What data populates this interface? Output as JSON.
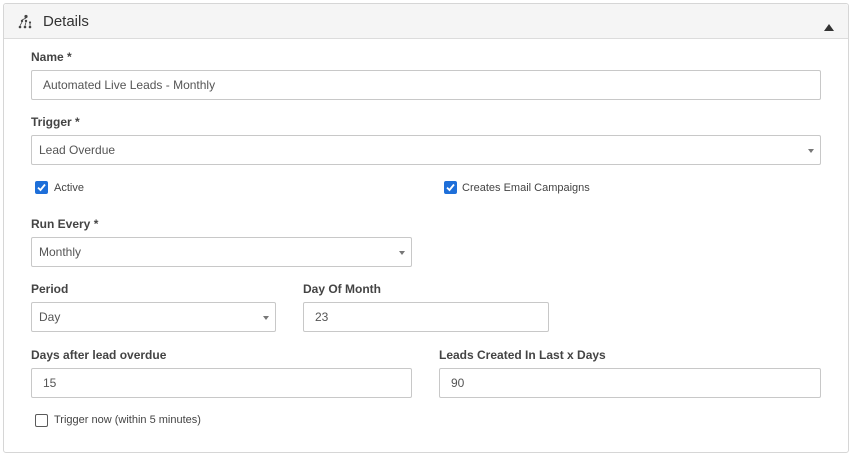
{
  "panel": {
    "title": "Details",
    "icon": "sitemap-icon",
    "collapse_icon": "caret-up-icon"
  },
  "form": {
    "name": {
      "label": "Name *",
      "value": "Automated Live Leads - Monthly"
    },
    "trigger": {
      "label": "Trigger *",
      "value": "Lead Overdue"
    },
    "active": {
      "label": "Active",
      "checked": true
    },
    "creates_email_campaigns": {
      "label": "Creates Email Campaigns",
      "checked": true
    },
    "run_every": {
      "label": "Run Every *",
      "value": "Monthly"
    },
    "period": {
      "label": "Period",
      "value": "Day"
    },
    "day_of_month": {
      "label": "Day Of Month",
      "value": "23"
    },
    "days_after_lead_overdue": {
      "label": "Days after lead overdue",
      "value": "15"
    },
    "leads_created_in_last_x_days": {
      "label": "Leads Created In Last x Days",
      "value": "90"
    },
    "trigger_now": {
      "label": "Trigger now (within 5 minutes)",
      "checked": false
    }
  },
  "colors": {
    "accent": "#1e6fd9",
    "header_bg": "#f5f5f5",
    "border": "#c8c8c8"
  }
}
